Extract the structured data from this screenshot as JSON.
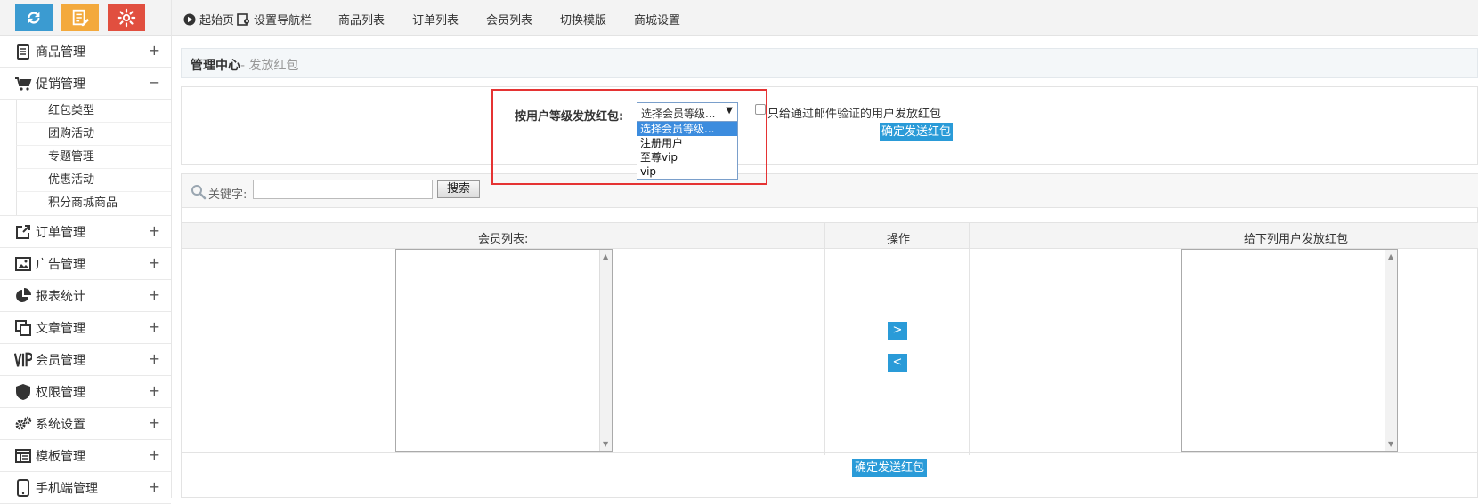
{
  "sidebar": {
    "top_buttons": [
      {
        "icon": "refresh-icon",
        "color": "#3b9bd1"
      },
      {
        "icon": "edit-icon",
        "color": "#f3a93c"
      },
      {
        "icon": "gear-icon",
        "color": "#e14f3f"
      }
    ],
    "menu": [
      {
        "label": "商品管理",
        "icon": "goods-icon",
        "toggle": "+"
      },
      {
        "label": "促销管理",
        "icon": "cart-icon",
        "toggle": "−"
      },
      {
        "label": "订单管理",
        "icon": "share-icon",
        "toggle": "+"
      },
      {
        "label": "广告管理",
        "icon": "image-icon",
        "toggle": "+"
      },
      {
        "label": "报表统计",
        "icon": "pie-chart-icon",
        "toggle": "+"
      },
      {
        "label": "文章管理",
        "icon": "copy-icon",
        "toggle": "+"
      },
      {
        "label": "会员管理",
        "icon": "vip-icon",
        "toggle": "+"
      },
      {
        "label": "权限管理",
        "icon": "shield-icon",
        "toggle": "+"
      },
      {
        "label": "系统设置",
        "icon": "gears-icon",
        "toggle": "+"
      },
      {
        "label": "模板管理",
        "icon": "template-icon",
        "toggle": "+"
      },
      {
        "label": "手机端管理",
        "icon": "mobile-icon",
        "toggle": "+"
      }
    ],
    "promo_submenu": [
      "红包类型",
      "团购活动",
      "专题管理",
      "优惠活动",
      "积分商城商品"
    ]
  },
  "topnav": {
    "home": "起始页",
    "set_nav": "设置导航栏",
    "links": [
      "商品列表",
      "订单列表",
      "会员列表",
      "切换模版",
      "商城设置"
    ]
  },
  "breadcrumb": {
    "root": "管理中心",
    "current": "- 发放红包"
  },
  "send_form": {
    "label": "按用户等级发放红包:",
    "select_value": "选择会员等级...",
    "options": [
      "选择会员等级...",
      "注册用户",
      "至尊vip",
      "vip"
    ],
    "checkbox_label": "只给通过邮件验证的用户发放红包",
    "confirm_button": "确定发送红包"
  },
  "search": {
    "label": "关键字:",
    "button": "搜索",
    "value": ""
  },
  "table": {
    "col_members": "会员列表:",
    "col_action": "操作",
    "col_target": "给下列用户发放红包",
    "add_button": ">",
    "remove_button": "<",
    "confirm_button": "确定发送红包"
  }
}
